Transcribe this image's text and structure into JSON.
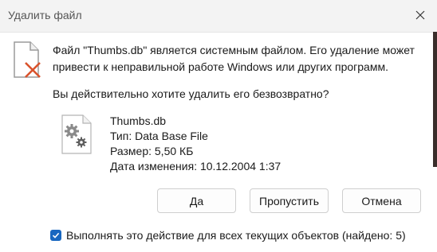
{
  "window": {
    "title": "Удалить файл"
  },
  "icons": {
    "close": "close-icon",
    "warning": "file-delete-warning-icon",
    "file": "system-file-gears-icon",
    "check": "checkmark-icon"
  },
  "message": {
    "line1": "Файл \"Thumbs.db\" является системным файлом. Его удаление может",
    "line2": "привести к неправильной работе Windows или других программ.",
    "question": "Вы действительно хотите удалить его безвозвратно?"
  },
  "file": {
    "name": "Thumbs.db",
    "type": "Тип: Data Base File",
    "size": "Размер: 5,50 КБ",
    "modified": "Дата изменения: 10.12.2004 1:37"
  },
  "buttons": {
    "yes": "Да",
    "skip": "Пропустить",
    "cancel": "Отмена"
  },
  "apply_all": {
    "label": "Выполнять это действие для всех текущих объектов (найдено: 5)",
    "checked": true
  },
  "colors": {
    "accent": "#1867c0",
    "warning_x": "#d9532c"
  }
}
